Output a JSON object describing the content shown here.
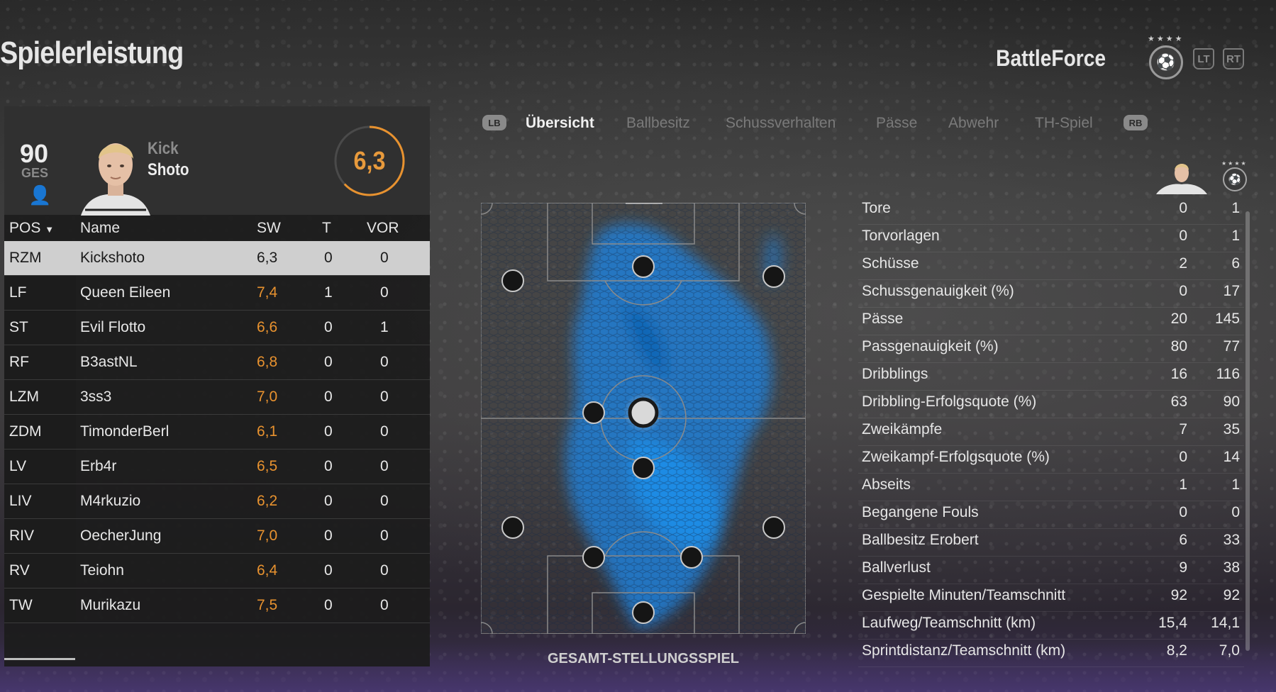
{
  "screen": {
    "title": "Spielerleistung",
    "club_name": "BattleForce",
    "left_trigger": "LT",
    "right_trigger": "RT",
    "crest_stars": "★★★★"
  },
  "player": {
    "overall": "90",
    "overall_label": "GES",
    "first_name": "Kick",
    "last_name": "Shoto",
    "rating": "6,3",
    "rating_fraction": 0.63
  },
  "table": {
    "headers": {
      "pos": "POS",
      "name": "Name",
      "sw": "SW",
      "t": "T",
      "vor": "VOR"
    },
    "sort_indicator": "▼",
    "rows": [
      {
        "pos": "RZM",
        "name": "Kickshoto",
        "sw": "6,3",
        "t": "0",
        "vor": "0"
      },
      {
        "pos": "LF",
        "name": "Queen Eileen",
        "sw": "7,4",
        "t": "1",
        "vor": "0"
      },
      {
        "pos": "ST",
        "name": "Evil Flotto",
        "sw": "6,6",
        "t": "0",
        "vor": "1"
      },
      {
        "pos": "RF",
        "name": "B3astNL",
        "sw": "6,8",
        "t": "0",
        "vor": "0"
      },
      {
        "pos": "LZM",
        "name": "3ss3",
        "sw": "7,0",
        "t": "0",
        "vor": "0"
      },
      {
        "pos": "ZDM",
        "name": "TimonderBerl",
        "sw": "6,1",
        "t": "0",
        "vor": "0"
      },
      {
        "pos": "LV",
        "name": "Erb4r",
        "sw": "6,5",
        "t": "0",
        "vor": "0"
      },
      {
        "pos": "LIV",
        "name": "M4rkuzio",
        "sw": "6,2",
        "t": "0",
        "vor": "0"
      },
      {
        "pos": "RIV",
        "name": "OecherJung",
        "sw": "7,0",
        "t": "0",
        "vor": "0"
      },
      {
        "pos": "RV",
        "name": "Teiohn",
        "sw": "6,4",
        "t": "0",
        "vor": "0"
      },
      {
        "pos": "TW",
        "name": "Murikazu",
        "sw": "7,5",
        "t": "0",
        "vor": "0"
      }
    ]
  },
  "tabs": {
    "left_bumper": "LB",
    "right_bumper": "RB",
    "items": [
      {
        "label": "Übersicht",
        "active": true
      },
      {
        "label": "Ballbesitz",
        "active": false
      },
      {
        "label": "Schussverhalten",
        "active": false
      },
      {
        "label": "Pässe",
        "active": false
      },
      {
        "label": "Abwehr",
        "active": false
      },
      {
        "label": "TH-Spiel",
        "active": false
      }
    ]
  },
  "heatmap": {
    "caption": "GESAMT-STELLUNGSSPIEL",
    "colors": {
      "heat": "#1f7fd6",
      "marker": "#151515",
      "selected": "#d9d9d9"
    }
  },
  "stats": {
    "rows": [
      {
        "label": "Tore",
        "player": "0",
        "team": "1"
      },
      {
        "label": "Torvorlagen",
        "player": "0",
        "team": "1"
      },
      {
        "label": "Schüsse",
        "player": "2",
        "team": "6"
      },
      {
        "label": "Schussgenauigkeit (%)",
        "player": "0",
        "team": "17"
      },
      {
        "label": "Pässe",
        "player": "20",
        "team": "145"
      },
      {
        "label": "Passgenauigkeit (%)",
        "player": "80",
        "team": "77"
      },
      {
        "label": "Dribblings",
        "player": "16",
        "team": "116"
      },
      {
        "label": "Dribbling-Erfolgsquote (%)",
        "player": "63",
        "team": "90"
      },
      {
        "label": "Zweikämpfe",
        "player": "7",
        "team": "35"
      },
      {
        "label": "Zweikampf-Erfolgsquote (%)",
        "player": "0",
        "team": "14"
      },
      {
        "label": "Abseits",
        "player": "1",
        "team": "1"
      },
      {
        "label": "Begangene Fouls",
        "player": "0",
        "team": "0"
      },
      {
        "label": "Ballbesitz Erobert",
        "player": "6",
        "team": "33"
      },
      {
        "label": "Ballverlust",
        "player": "9",
        "team": "38"
      },
      {
        "label": "Gespielte Minuten/Teamschnitt",
        "player": "92",
        "team": "92"
      },
      {
        "label": "Laufweg/Teamschnitt (km)",
        "player": "15,4",
        "team": "14,1"
      },
      {
        "label": "Sprintdistanz/Teamschnitt (km)",
        "player": "8,2",
        "team": "7,0"
      }
    ]
  },
  "colors": {
    "accent": "#e8922f",
    "selected_row": "#cfcfcf"
  }
}
